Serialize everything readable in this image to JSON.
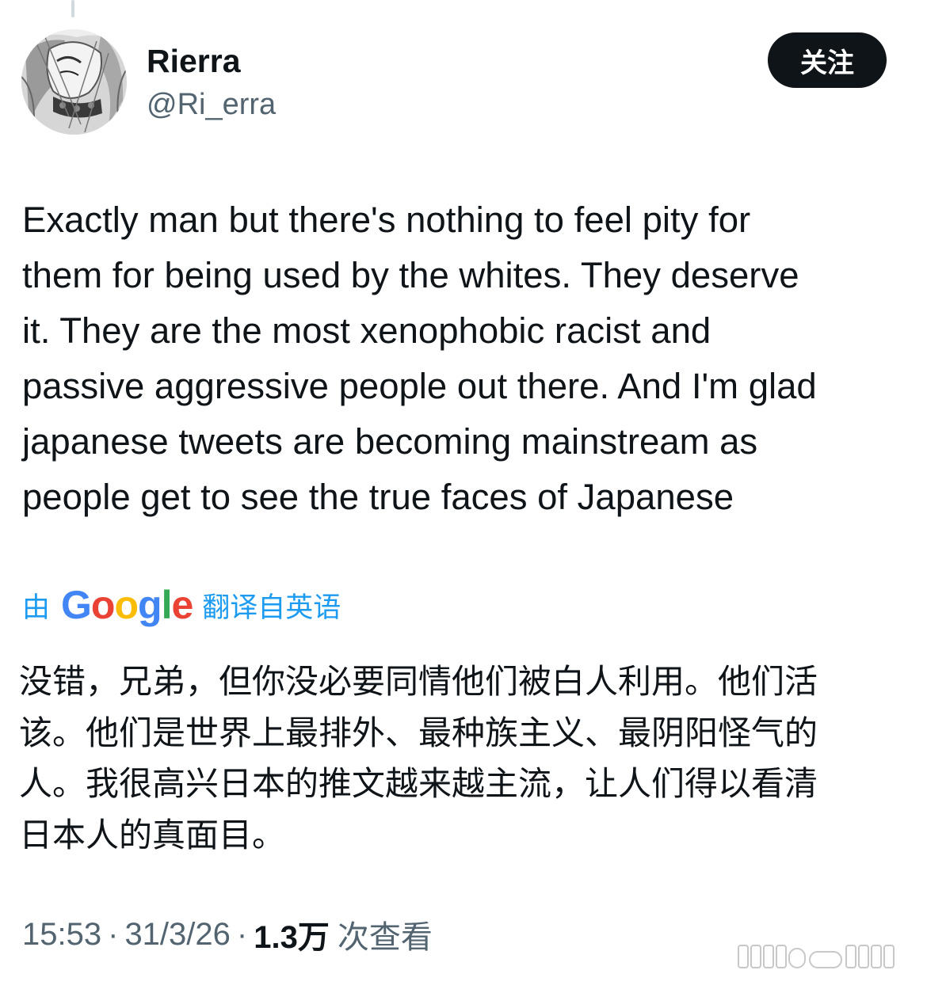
{
  "user": {
    "display_name": "Rierra",
    "handle": "@Ri_erra"
  },
  "follow_button": {
    "label": "关注"
  },
  "tweet": {
    "lines": [
      "Exactly man but there's nothing to feel pity for",
      "them for being used by the whites. They deserve",
      "it. They are the most xenophobic racist and",
      "passive aggressive people out there. And I'm glad",
      "japanese tweets are becoming mainstream as",
      "people get to see the true faces of Japanese"
    ]
  },
  "translation_notice": {
    "prefix": "由",
    "brand": "Google",
    "suffix": "翻译自英语"
  },
  "translation": {
    "lines": [
      "没错，兄弟，但你没必要同情他们被白人利用。他们活",
      "该。他们是世界上最排外、最种族主义、最阴阳怪气的",
      "人。我很高兴日本的推文越来越主流，让人们得以看清",
      "日本人的真面目。"
    ]
  },
  "meta": {
    "time": "15:53",
    "date": "31/3/26",
    "separator": "·",
    "views_count": "1.3万",
    "views_label": "次查看"
  },
  "icons": {
    "avatar": "manga-character-avatar",
    "google_logo": "google-wordmark",
    "watermark": "platform-watermark"
  },
  "colors": {
    "follow_bg": "#0f1419",
    "link_blue": "#1d9bf0",
    "secondary_text": "#536471",
    "google_blue": "#4285f4",
    "google_red": "#ea4335",
    "google_yellow": "#fbbc05",
    "google_green": "#34a853"
  }
}
